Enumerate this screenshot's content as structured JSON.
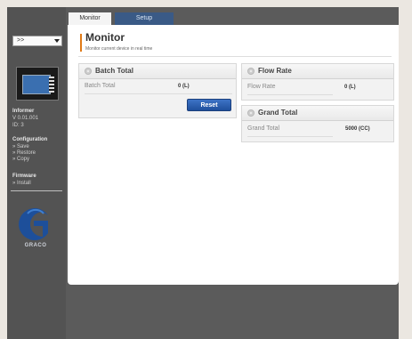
{
  "sidebar": {
    "dropdown_value": ">>",
    "info": {
      "title": "Informer",
      "version": "V 0.01.001",
      "id": "ID: 3"
    },
    "configuration": {
      "heading": "Configuration",
      "items": [
        "» Save",
        "» Restore",
        "» Copy"
      ]
    },
    "firmware": {
      "heading": "Firmware",
      "items": [
        "» Install"
      ]
    },
    "logo_text": "GRACO"
  },
  "tabs": [
    {
      "label": "Monitor",
      "active": true
    },
    {
      "label": "Setup",
      "active": false
    }
  ],
  "page": {
    "title": "Monitor",
    "subtitle": "Monitor current device in real time"
  },
  "cards": {
    "batch_total": {
      "title": "Batch Total",
      "label": "Batch Total",
      "value": "0 (L)",
      "reset_label": "Reset"
    },
    "flow_rate": {
      "title": "Flow Rate",
      "label": "Flow Rate",
      "value": "0 (L)"
    },
    "grand_total": {
      "title": "Grand Total",
      "label": "Grand Total",
      "value": "5000 (CC)"
    }
  },
  "colors": {
    "accent": "#e07a17",
    "button": "#2a5caa",
    "tab_setup": "#3a5a86"
  }
}
